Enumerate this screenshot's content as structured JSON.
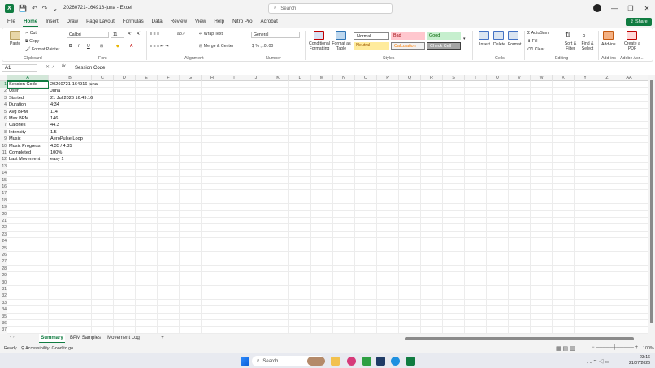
{
  "window": {
    "title": "20260721-164916-juna  -  Excel",
    "search_placeholder": "Search",
    "minimize": "—",
    "restore": "❐",
    "close": "✕"
  },
  "menu": {
    "tabs": [
      "File",
      "Home",
      "Insert",
      "Draw",
      "Page Layout",
      "Formulas",
      "Data",
      "Review",
      "View",
      "Help",
      "Nitro Pro",
      "Acrobat"
    ],
    "active": "Home",
    "share": "Share"
  },
  "ribbon": {
    "clipboard": {
      "paste": "Paste",
      "cut": "Cut",
      "copy": "Copy",
      "format_painter": "Format Painter",
      "label": "Clipboard"
    },
    "font": {
      "name": "Calibri",
      "size": "11",
      "bold": "B",
      "italic": "I",
      "underline": "U",
      "label": "Font"
    },
    "alignment": {
      "wrap": "Wrap Text",
      "merge": "Merge & Center",
      "label": "Alignment"
    },
    "number": {
      "format": "General",
      "label": "Number"
    },
    "styles": {
      "conditional": "Conditional Formatting",
      "format_table": "Format as Table",
      "normal": "Normal",
      "bad": "Bad",
      "good": "Good",
      "neutral": "Neutral",
      "calculation": "Calculation",
      "check_cell": "Check Cell",
      "label": "Styles"
    },
    "cells": {
      "insert": "Insert",
      "delete": "Delete",
      "format": "Format",
      "label": "Cells"
    },
    "editing": {
      "autosum": "AutoSum",
      "fill": "Fill",
      "clear": "Clear",
      "sort": "Sort & Filter",
      "find": "Find & Select",
      "label": "Editing"
    },
    "addins": {
      "addins": "Add-ins",
      "label": "Add-ins"
    },
    "adobe": {
      "create_pdf": "Create a PDF",
      "label": "Adobe Acr..."
    }
  },
  "formula_bar": {
    "name_box": "A1",
    "fx": "fx",
    "content": "Session Code"
  },
  "grid": {
    "columns": [
      "A",
      "B",
      "C",
      "D",
      "E",
      "F",
      "G",
      "H",
      "I",
      "J",
      "K",
      "L",
      "M",
      "N",
      "O",
      "P",
      "Q",
      "R",
      "S",
      "T",
      "U",
      "V",
      "W",
      "X",
      "Y",
      "Z",
      "AA",
      "AB"
    ],
    "row_count": 37,
    "cells": [
      [
        "Session Code",
        "20260721-164916-juna"
      ],
      [
        "User",
        "Juna"
      ],
      [
        "Started",
        "21 Jul 2026 16:49:16"
      ],
      [
        "Duration",
        "4:34"
      ],
      [
        "Avg BPM",
        "114"
      ],
      [
        "Max BPM",
        "146"
      ],
      [
        "Calories",
        "44.3"
      ],
      [
        "Intensity",
        "1.5"
      ],
      [
        "Music",
        "AeroPulse Loop"
      ],
      [
        "Music Progress",
        "4:35 / 4:35"
      ],
      [
        "Completed",
        "100%"
      ],
      [
        "Last Movement",
        "easy 1"
      ]
    ]
  },
  "sheets": {
    "tabs": [
      "Summary",
      "BPM Samples",
      "Movement Log"
    ],
    "active": "Summary",
    "add": "+"
  },
  "status": {
    "ready": "Ready",
    "accessibility": "Accessibility: Good to go",
    "zoom": "100%"
  },
  "taskbar": {
    "search": "Search",
    "time": "23:16",
    "date": "21/07/2026"
  },
  "colors": {
    "accent": "#107c41",
    "bad_bg": "#ffc7ce",
    "good_bg": "#c6efce",
    "neutral_bg": "#ffeb9c",
    "check_bg": "#a5a5a5"
  }
}
